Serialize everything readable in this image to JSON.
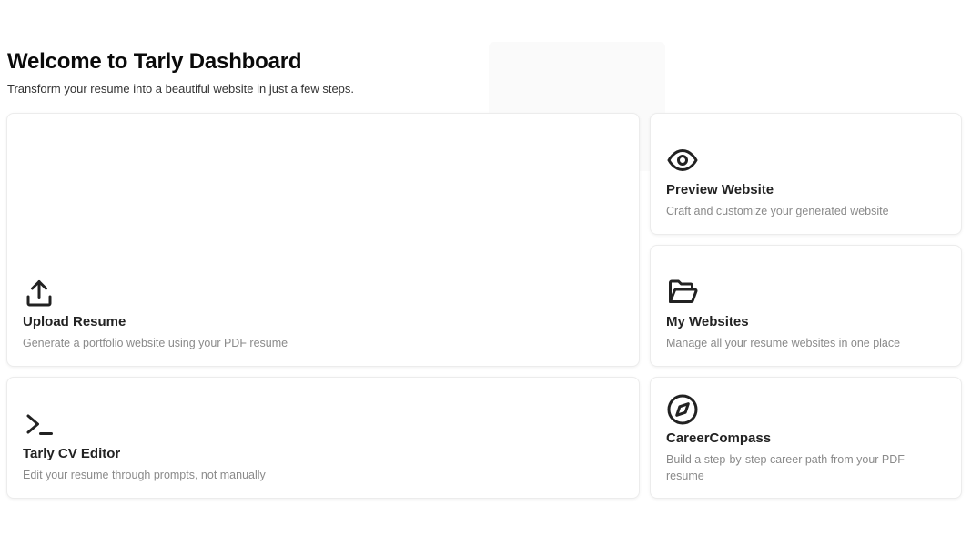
{
  "header": {
    "title": "Welcome to Tarly Dashboard",
    "subtitle": "Transform your resume into a beautiful website in just a few steps."
  },
  "cards": {
    "upload": {
      "icon": "upload-icon",
      "title": "Upload Resume",
      "description": "Generate a portfolio website using your PDF resume"
    },
    "editor": {
      "icon": "terminal-icon",
      "title": "Tarly CV Editor",
      "description": "Edit your resume through prompts, not manually"
    },
    "preview": {
      "icon": "eye-icon",
      "title": "Preview Website",
      "description": "Craft and customize your generated website"
    },
    "websites": {
      "icon": "folder-open-icon",
      "title": "My Websites",
      "description": "Manage all your resume websites in one place"
    },
    "compass": {
      "icon": "compass-icon",
      "title": "CareerCompass",
      "description": "Build a step-by-step career path from your PDF resume"
    }
  },
  "colors": {
    "background": "#ffffff",
    "card_border": "#ececec",
    "title_text": "#0a0a0a",
    "muted_text": "#8a8a8a",
    "icon_stroke": "#222222"
  }
}
